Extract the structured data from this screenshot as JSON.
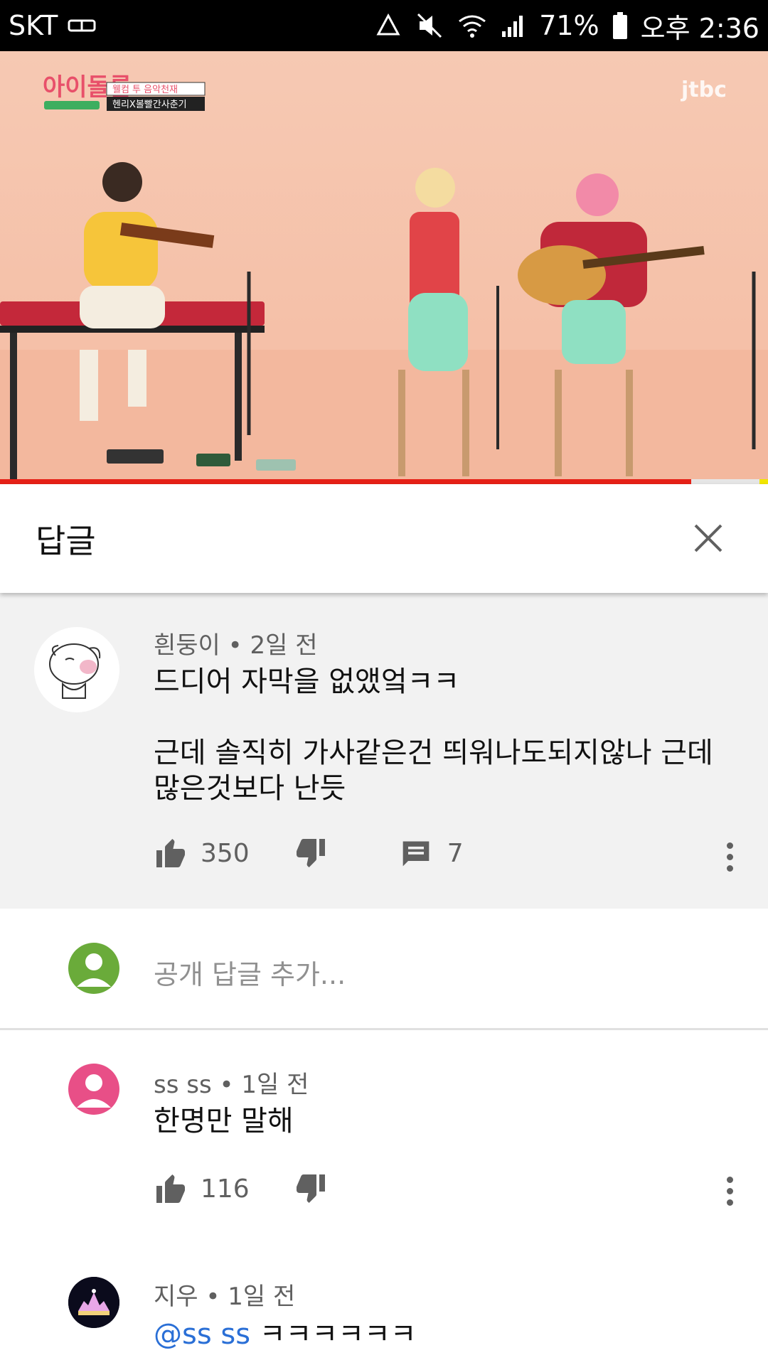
{
  "status_bar": {
    "carrier": "SKT",
    "battery_percent": "71%",
    "time": "오후 2:36"
  },
  "video": {
    "show_logo_main": "아이돌룸",
    "show_banner_line1": "웰컴 투 음악천재",
    "show_banner_line2": "헨리X볼빨간사춘기",
    "channel_logo": "jtbc",
    "progress": 0.9
  },
  "header": {
    "title": "답글"
  },
  "parent_comment": {
    "author": "흰둥이",
    "time": "2일 전",
    "text_line1": "드디어 자막을 없앴엌ㅋㅋ",
    "text_line2": "근데 솔직히 가사같은건 띄워나도되지않나 근데",
    "text_line3": "많은것보다 난듯",
    "likes": "350",
    "reply_count": "7"
  },
  "add_reply": {
    "placeholder": "공개 답글 추가..."
  },
  "replies": [
    {
      "author": "ss ss",
      "time": "1일 전",
      "text": "한명만 말해",
      "likes": "116",
      "avatar_color": "#e84f87"
    },
    {
      "author": "지우",
      "time": "1일 전",
      "mention": "@ss ss",
      "text": "ㅋㅋㅋㅋㅋㅋ"
    }
  ],
  "colors": {
    "accent_red": "#e62117",
    "link_blue": "#2a6fd6",
    "my_avatar": "#6aab3a"
  },
  "separator": "•"
}
